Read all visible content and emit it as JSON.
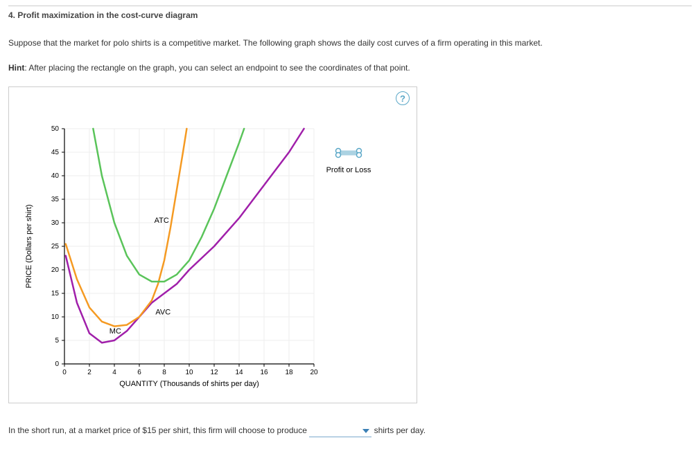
{
  "question": {
    "number": "4.",
    "title": "Profit maximization in the cost-curve diagram"
  },
  "intro": "Suppose that the market for polo shirts is a competitive market. The following graph shows the daily cost curves of a firm operating in this market.",
  "hint_label": "Hint",
  "hint_text": ": After placing the rectangle on the graph, you can select an endpoint to see the coordinates of that point.",
  "help_icon": "?",
  "chart_data": {
    "type": "line",
    "xlabel": "QUANTITY (Thousands of shirts per day)",
    "ylabel": "PRICE (Dollars per shirt)",
    "xlim": [
      0,
      20
    ],
    "ylim": [
      0,
      50
    ],
    "x_ticks": [
      0,
      2,
      4,
      6,
      8,
      10,
      12,
      14,
      16,
      18,
      20
    ],
    "y_ticks": [
      0,
      5,
      10,
      15,
      20,
      25,
      30,
      35,
      40,
      45,
      50
    ],
    "series": [
      {
        "name": "MC",
        "color": "#a01faa",
        "label_at": {
          "x": 3.6,
          "y": 6.5
        },
        "points": [
          {
            "x": 0.1,
            "y": 23
          },
          {
            "x": 1,
            "y": 13
          },
          {
            "x": 2,
            "y": 6.5
          },
          {
            "x": 3,
            "y": 4.5
          },
          {
            "x": 4,
            "y": 5
          },
          {
            "x": 5,
            "y": 7
          },
          {
            "x": 6,
            "y": 10
          },
          {
            "x": 7,
            "y": 13
          },
          {
            "x": 8,
            "y": 15
          },
          {
            "x": 9,
            "y": 17
          },
          {
            "x": 10,
            "y": 20
          },
          {
            "x": 12,
            "y": 25
          },
          {
            "x": 14,
            "y": 31
          },
          {
            "x": 16,
            "y": 38
          },
          {
            "x": 18,
            "y": 45
          },
          {
            "x": 19.2,
            "y": 50
          }
        ]
      },
      {
        "name": "AVC",
        "color": "#f59a22",
        "label_at": {
          "x": 7.3,
          "y": 10.5
        },
        "points": [
          {
            "x": 0.1,
            "y": 25.5
          },
          {
            "x": 1,
            "y": 18
          },
          {
            "x": 2,
            "y": 12
          },
          {
            "x": 3,
            "y": 9
          },
          {
            "x": 4,
            "y": 8
          },
          {
            "x": 5,
            "y": 8.3
          },
          {
            "x": 6,
            "y": 10
          },
          {
            "x": 7,
            "y": 13.5
          },
          {
            "x": 7.5,
            "y": 17
          },
          {
            "x": 8,
            "y": 22
          },
          {
            "x": 8.5,
            "y": 29
          },
          {
            "x": 9,
            "y": 37
          },
          {
            "x": 9.5,
            "y": 45
          },
          {
            "x": 9.8,
            "y": 50
          }
        ]
      },
      {
        "name": "ATC",
        "color": "#5ac45a",
        "label_at": {
          "x": 7.2,
          "y": 30
        },
        "points": [
          {
            "x": 2.3,
            "y": 50
          },
          {
            "x": 3,
            "y": 40
          },
          {
            "x": 4,
            "y": 30
          },
          {
            "x": 5,
            "y": 23
          },
          {
            "x": 6,
            "y": 19
          },
          {
            "x": 7,
            "y": 17.5
          },
          {
            "x": 8,
            "y": 17.5
          },
          {
            "x": 9,
            "y": 19
          },
          {
            "x": 10,
            "y": 22
          },
          {
            "x": 11,
            "y": 27
          },
          {
            "x": 12,
            "y": 33
          },
          {
            "x": 13,
            "y": 40
          },
          {
            "x": 14,
            "y": 47
          },
          {
            "x": 14.4,
            "y": 50
          }
        ]
      }
    ],
    "legend": {
      "label": "Profit or Loss",
      "color": "#5aa7c7"
    }
  },
  "sentence": {
    "prefix": "In the short run, at a market price of $15 per shirt, this firm will choose to produce",
    "dropdown_value": "",
    "suffix": " shirts per day."
  }
}
